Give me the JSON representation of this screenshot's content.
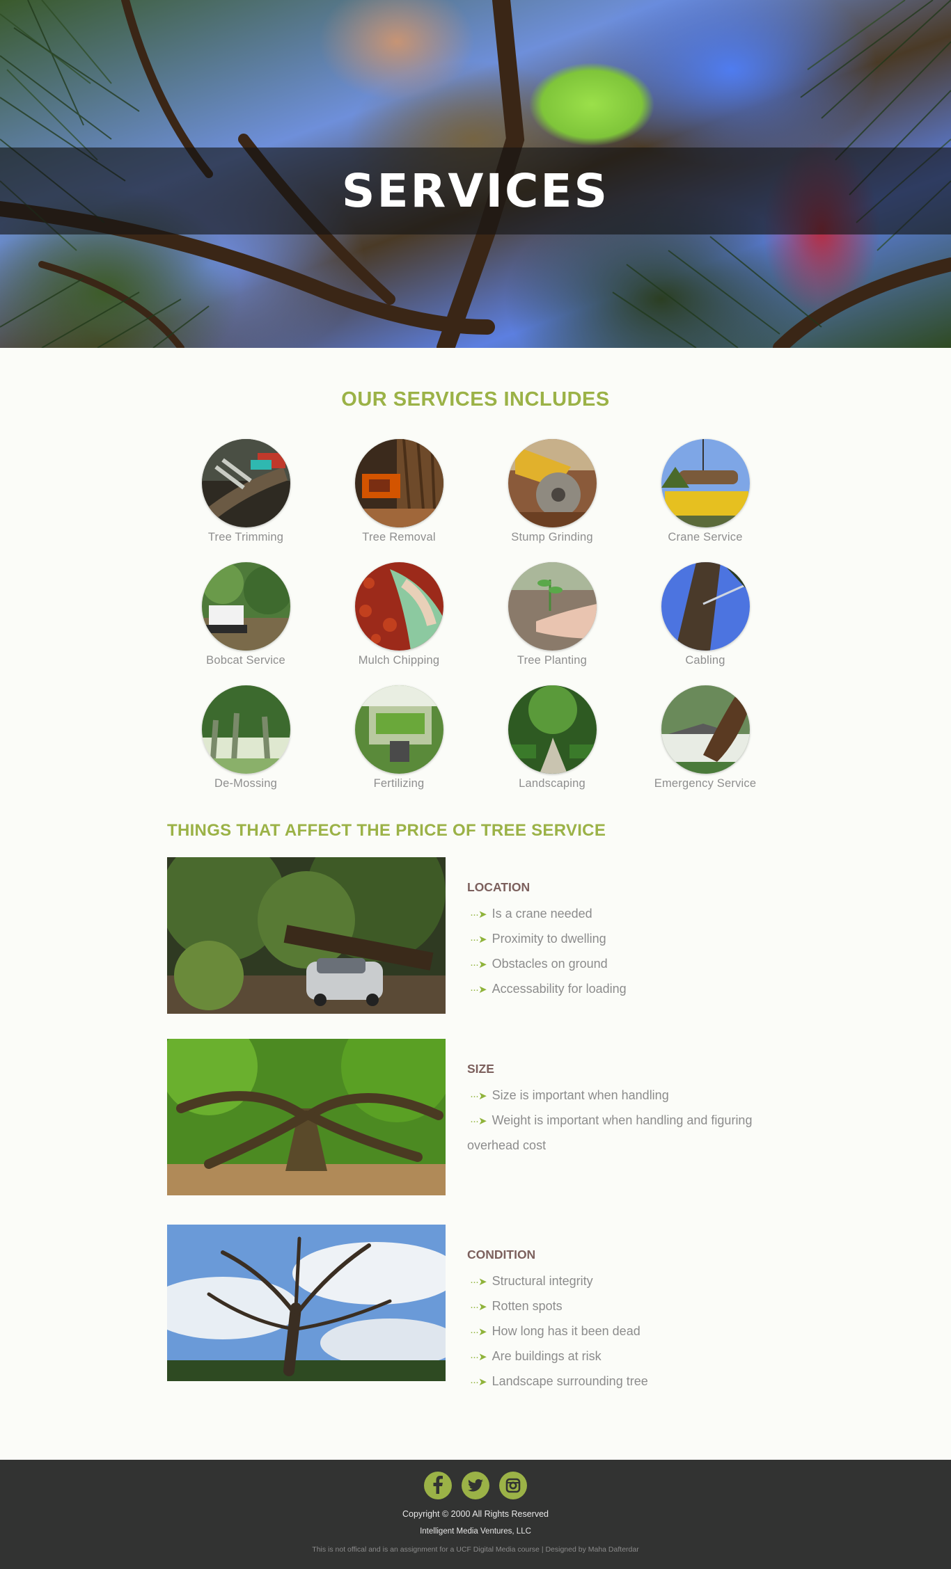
{
  "hero": {
    "title": "SERVICES"
  },
  "services": {
    "heading": "OUR SERVICES INCLUDES",
    "items": [
      {
        "label": "Tree Trimming",
        "icon": "tree-trimming-photo"
      },
      {
        "label": "Tree Removal",
        "icon": "tree-removal-photo"
      },
      {
        "label": "Stump Grinding",
        "icon": "stump-grinding-photo"
      },
      {
        "label": "Crane Service",
        "icon": "crane-service-photo"
      },
      {
        "label": "Bobcat Service",
        "icon": "bobcat-service-photo"
      },
      {
        "label": "Mulch Chipping",
        "icon": "mulch-chipping-photo"
      },
      {
        "label": "Tree Planting",
        "icon": "tree-planting-photo"
      },
      {
        "label": "Cabling",
        "icon": "cabling-photo"
      },
      {
        "label": "De-Mossing",
        "icon": "de-mossing-photo"
      },
      {
        "label": "Fertilizing",
        "icon": "fertilizing-photo"
      },
      {
        "label": "Landscaping",
        "icon": "landscaping-photo"
      },
      {
        "label": "Emergency Service",
        "icon": "emergency-service-photo"
      }
    ]
  },
  "factors": {
    "heading": "THINGS THAT AFFECT THE PRICE OF TREE SERVICE",
    "location": {
      "title": "LOCATION",
      "items": [
        "Is a crane needed",
        "Proximity to dwelling",
        "Obstacles on ground",
        "Accessability for loading"
      ]
    },
    "size": {
      "title": "SIZE",
      "items": [
        "Size is important when handling",
        "Weight is important when handling and figuring"
      ],
      "continuation": "overhead cost"
    },
    "condition": {
      "title": "CONDITION",
      "items": [
        "Structural integrity",
        "Rotten spots",
        "How long has it been dead",
        "Are buildings at risk",
        "Landscape surrounding tree"
      ]
    }
  },
  "footer": {
    "socials": [
      "facebook-icon",
      "twitter-icon",
      "instagram-icon"
    ],
    "copyright": "Copyright © 2000 All Rights Reserved",
    "company": "Intelligent Media Ventures, LLC",
    "note": "This is not offical and is an assignment for a UCF Digital Media course | Designed by Maha Dafterdar"
  },
  "colors": {
    "accent": "#9bb247",
    "footer_bg": "#323332",
    "factor_title": "#7c605d",
    "page_bg": "#fbfcf8"
  }
}
